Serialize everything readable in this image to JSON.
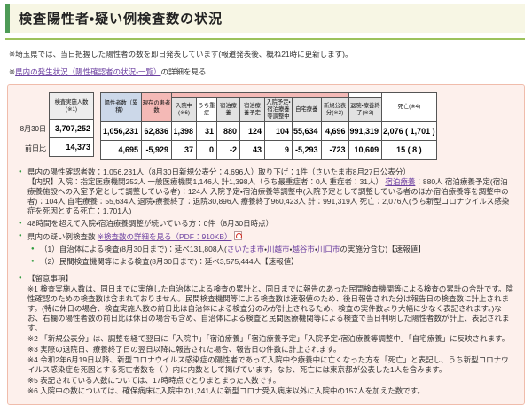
{
  "icons": {
    "bullet": "●"
  },
  "header": {
    "title": "検査陽性者・疑い例検査数の状況",
    "update_note": "※埼玉県では、当日把握した陽性者の数を即日発表しています(報道発表後、概ね21時に更新します)。",
    "status_link_prefix": "※",
    "status_link_label": "県内の発生状況（陽性確認者の状況・一覧）",
    "status_link_suffix": "の詳細を見る"
  },
  "table": {
    "row_labels": [
      "8月30日",
      "前日比"
    ],
    "test_column": {
      "header": "検査実施人数(※1)",
      "values": [
        "3,707,252",
        "14,373"
      ]
    },
    "columns": [
      {
        "header": "陽性者数（累積）",
        "values": [
          "1,056,231",
          "4,695"
        ]
      },
      {
        "header": "現在の患者数",
        "values": [
          "62,836",
          "-5,929"
        ]
      },
      {
        "header": "入院中(※6)",
        "values": [
          "1,398",
          "37"
        ]
      },
      {
        "header": "うち重症",
        "values": [
          "31",
          "0"
        ]
      },
      {
        "header": "宿泊療養",
        "values": [
          "880",
          "-2"
        ]
      },
      {
        "header": "宿泊療養予定",
        "values": [
          "124",
          "43"
        ]
      },
      {
        "header": "入院予定・宿泊療養等調整中",
        "values": [
          "104",
          "9"
        ]
      },
      {
        "header": "自宅療養",
        "values": [
          "55,634",
          "-5,293"
        ]
      },
      {
        "header": "新規公表分(※2)",
        "values": [
          "4,696",
          "-723"
        ]
      },
      {
        "header": "退院・療養終了(※3)",
        "values": [
          "991,319",
          "10,609"
        ]
      },
      {
        "header": "死亡(※4)",
        "values": [
          "2,076 ( 1,701 )",
          "15 ( 8 )"
        ]
      }
    ]
  },
  "list": {
    "item1_line1": "県内の陽性確認者数：1,056,231人（8月30日新規公表分：4,696人）取り下げ：1件（さいたま市8月27日公表分）",
    "item1_line2_pre": "【内訳】入院：指定医療機関252人 一般医療機関1,146人 計1,398人（うち最重症者：0人 重症者：31人） ",
    "item1_link": "宿泊療養",
    "item1_line2_post": "：880人 宿泊療養予定(宿泊療養施設への入室予定として調整している者)：124人 入院予定・宿泊療養等調整中(入院予定として調整している者のほか宿泊療養等を調整中の者)：104人 自宅療養：55,634人 退院・療養終了：退院30,896人 療養終了960,423人 計：991,319人 死亡：2,076人(うち新型コロナウイルス感染症を死因とする死亡：1,701人)",
    "item2": "48時間を超えて入院・宿泊療養調整が続いている方：0件（8月30日時点）",
    "item3_text": "県内の疑い例検査数 ",
    "item3_link": "※検査数の詳細を見る（PDF：910KB）",
    "sub1_pre": "（1）自治体による検査(8月30日まで)：延べ131,808人(",
    "sub1_city1": "さいたま市",
    "sub1_sep1": "・",
    "sub1_city2": "川越市",
    "sub1_sep2": "・",
    "sub1_city3": "越谷市",
    "sub1_sep3": "・",
    "sub1_city4": "川口市",
    "sub1_post": "の実施分含む)【速報値】",
    "sub2": "（2）民間検査機関等による検査(8月30日まで)：延べ3,575,444人【速報値】",
    "notes_title": "【留意事項】",
    "note1": "※1 検査実施人数は、同日までに実施した自治体による検査の累計と、同日までに報告のあった民間検査機関等による検査の累計の合計です。陰性確認のための検査数は含まれておりません。民間検査機関等による検査数は速報値のため、後日報告された分は報告日の検査数に計上されます。(特に休日の場合、検査実施人数の前日比は自治体による検査分のみが計上されるため、検査の実件数より大幅に少なく表記されます。)なお、右欄の陽性者数の前日比は休日の場合も含め、自治体による検査と民間医療機関等による検査で当日判明した陽性者数が計上、表記されます。",
    "note2": "※2 「新規公表分」は、調整を経て翌日に「入院中」「宿泊療養」「宿泊療養予定」「入院予定・宿泊療養等調整中」「自宅療養」に反映されます。",
    "note3": "※3 実際の退院日、療養終了日の翌日以降に報告された場合、報告日の件数に計上されます。",
    "note4": "※4 令和2年6月19日以降、新型コロナウイルス感染症の陽性者であって入院中や療養中に亡くなった方を「死亡」と表記し、うち新型コロナウイルス感染症を死因とする死亡者数を（ ）内に内数として掲げています。なお、死亡には東京都が公表した1人を含みます。",
    "note5": "※5 表記されている人数については、17時時点でとりまとまった人数です。",
    "note6": "※6 入院中の数については、確保病床に入院中の1,241人に新型コロナ受入病床以外に入院中の157人を加えた数です。"
  }
}
